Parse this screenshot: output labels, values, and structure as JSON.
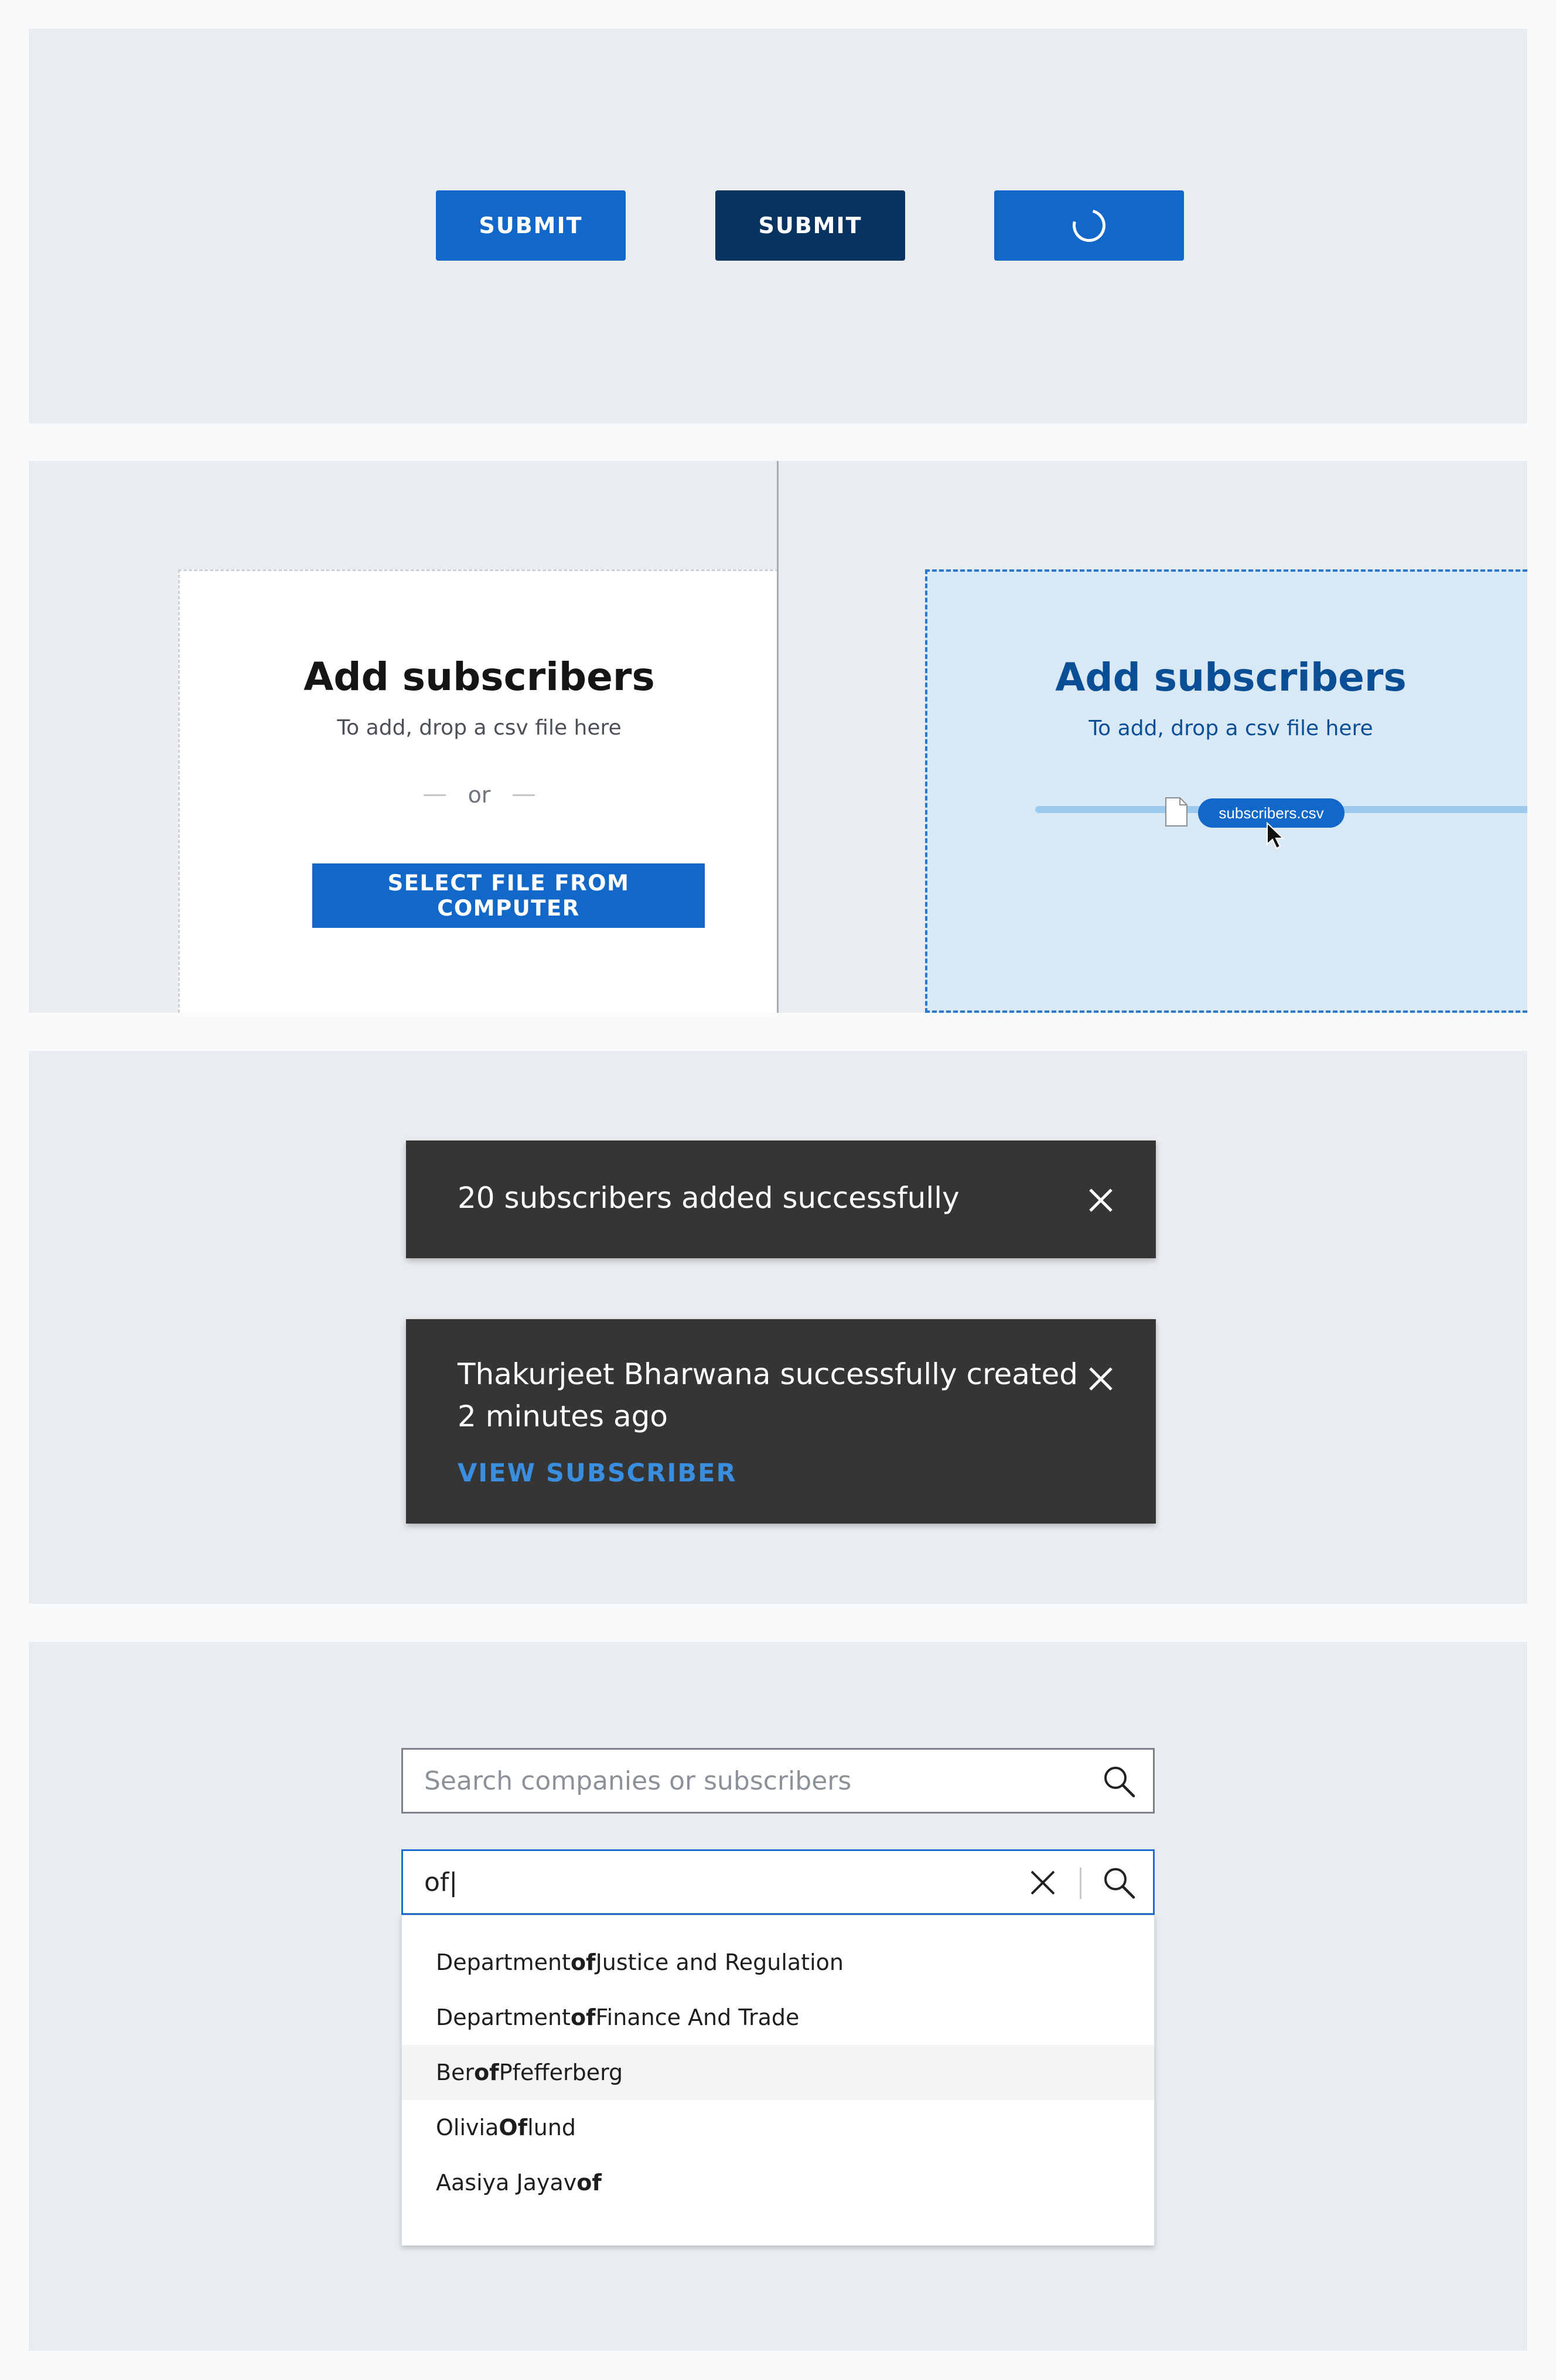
{
  "buttons": {
    "submit_label": "SUBMIT",
    "submit_pressed_label": "SUBMIT",
    "loading_indicator": "spinner-icon"
  },
  "upload": {
    "idle": {
      "title": "Add subscribers",
      "subtitle": "To add, drop a csv file here",
      "or_text": "or",
      "select_button": "SELECT FILE FROM COMPUTER"
    },
    "active": {
      "title": "Add subscribers",
      "subtitle": "To add, drop a csv file here",
      "dragged_file": "subscribers.csv",
      "file_icon": "file-icon",
      "cursor_icon": "cursor-arrow-icon"
    }
  },
  "toasts": [
    {
      "message": "20 subscribers added successfully",
      "close_icon": "close-icon"
    },
    {
      "message_line1": "Thakurjeet Bharwana successfully created",
      "message_line2": "2 minutes ago",
      "action": "VIEW SUBSCRIBER",
      "close_icon": "close-icon"
    }
  ],
  "search": {
    "empty": {
      "placeholder": "Search companies or subscribers",
      "icon": "search-icon"
    },
    "active": {
      "value": "of|",
      "clear_icon": "clear-icon",
      "icon": "search-icon",
      "results": [
        {
          "pre": "Department ",
          "match": "of",
          "post": " Justice and Regulation"
        },
        {
          "pre": "Department ",
          "match": "of",
          "post": " Finance And Trade"
        },
        {
          "pre": "Ber",
          "match": "of",
          "post": " Pfefferberg"
        },
        {
          "pre": "Olivia ",
          "match": "Of",
          "post": "lund"
        },
        {
          "pre": "Aasiya Jayav",
          "match": "of",
          "post": ""
        }
      ],
      "highlighted_index": 2
    }
  },
  "colors": {
    "primary": "#1168c9",
    "primary_pressed": "#083361",
    "toast_bg": "#353535",
    "link": "#3a8ee0",
    "active_title": "#0a4f96"
  }
}
